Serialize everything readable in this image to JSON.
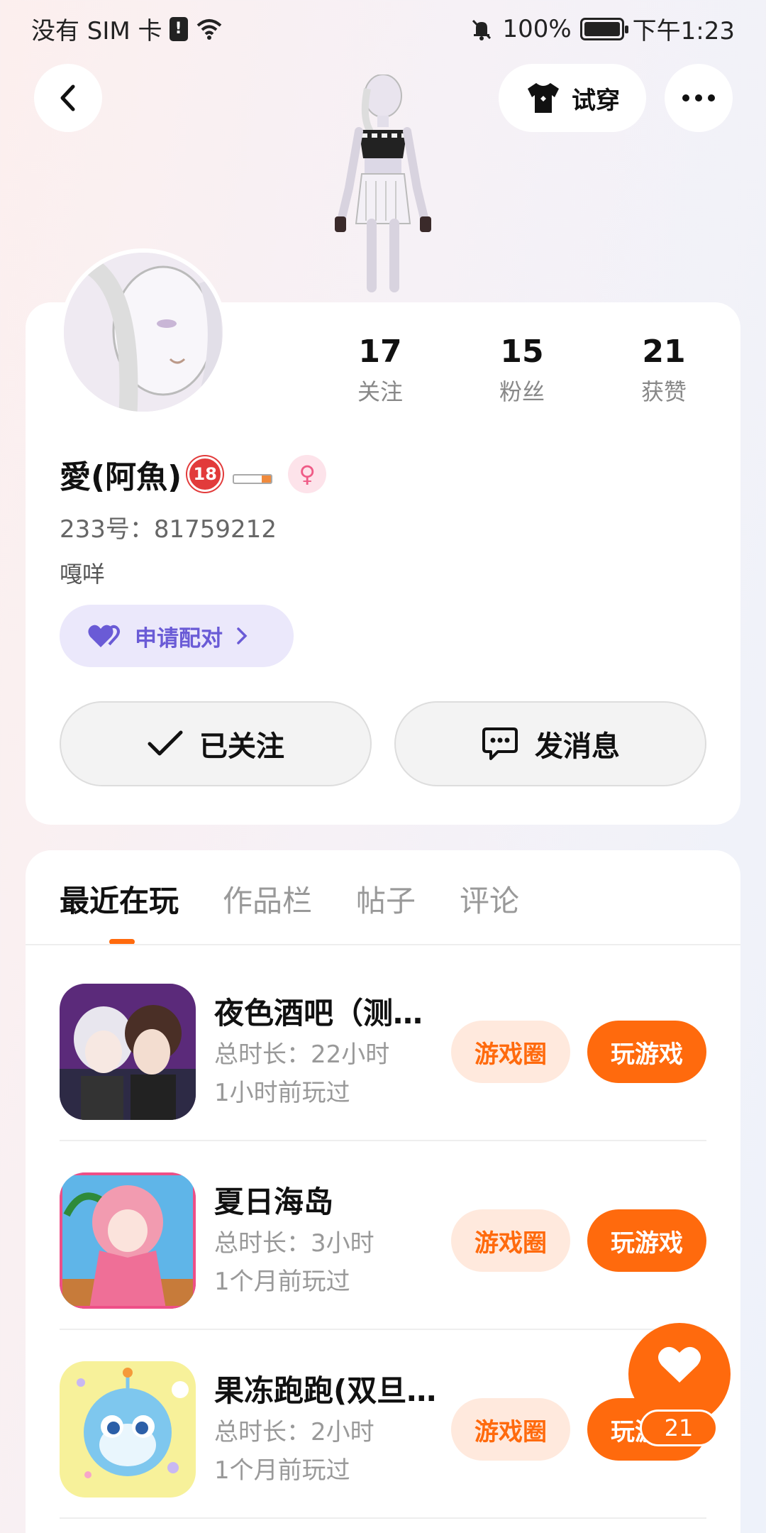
{
  "status_bar": {
    "left": "没有 SIM 卡",
    "sim_alert": "!",
    "battery": "100%",
    "time": "下午1:23"
  },
  "header": {
    "tryon_label": "试穿"
  },
  "profile": {
    "stats": [
      {
        "value": "17",
        "label": "关注"
      },
      {
        "value": "15",
        "label": "粉丝"
      },
      {
        "value": "21",
        "label": "获赞"
      }
    ],
    "username": "愛(阿魚)",
    "age_badge": "18",
    "gender_symbol": "♀",
    "uid": "233号：81759212",
    "bio": "嘎咩",
    "pair_label": "申请配对",
    "follow_label": "已关注",
    "message_label": "发消息"
  },
  "tabs": [
    "最近在玩",
    "作品栏",
    "帖子",
    "评论"
  ],
  "games": [
    {
      "title": "夜色酒吧（测…",
      "duration": "总时长：22小时",
      "last_played": "1小时前玩过",
      "circle_label": "游戏圈",
      "play_label": "玩游戏"
    },
    {
      "title": "夏日海岛",
      "duration": "总时长：3小时",
      "last_played": "1个月前玩过",
      "circle_label": "游戏圈",
      "play_label": "玩游戏"
    },
    {
      "title": "果冻跑跑(双旦…",
      "duration": "总时长：2小时",
      "last_played": "1个月前玩过",
      "circle_label": "游戏圈",
      "play_label": "玩游戏"
    }
  ],
  "like": {
    "count": "21"
  },
  "colors": {
    "accent": "#ff6a0d",
    "pair": "#6a5bd6"
  }
}
